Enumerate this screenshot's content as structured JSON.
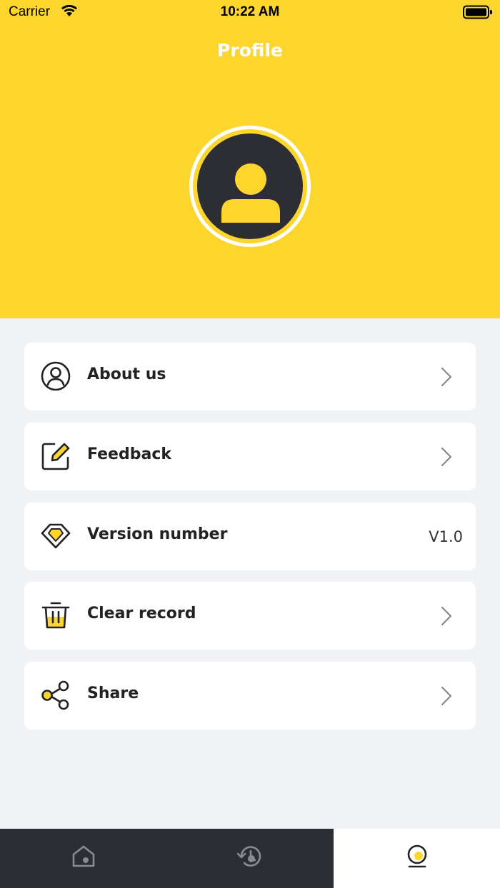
{
  "status_bar": {
    "carrier": "Carrier",
    "time": "10:22 AM"
  },
  "header": {
    "title": "Profile"
  },
  "menu": {
    "items": [
      {
        "label": "About us",
        "icon": "user-circle-icon"
      },
      {
        "label": "Feedback",
        "icon": "edit-icon"
      },
      {
        "label": "Version number",
        "icon": "diamond-icon",
        "value": "V1.0"
      },
      {
        "label": "Clear record",
        "icon": "trash-icon"
      },
      {
        "label": "Share",
        "icon": "share-icon"
      }
    ]
  },
  "tabbar": {
    "tabs": [
      {
        "icon": "home-icon",
        "active": false
      },
      {
        "icon": "history-icon",
        "active": false
      },
      {
        "icon": "profile-icon",
        "active": true
      }
    ]
  },
  "colors": {
    "accent": "#FCD62C",
    "dark": "#2D2E33",
    "background": "#F1F2F6"
  }
}
